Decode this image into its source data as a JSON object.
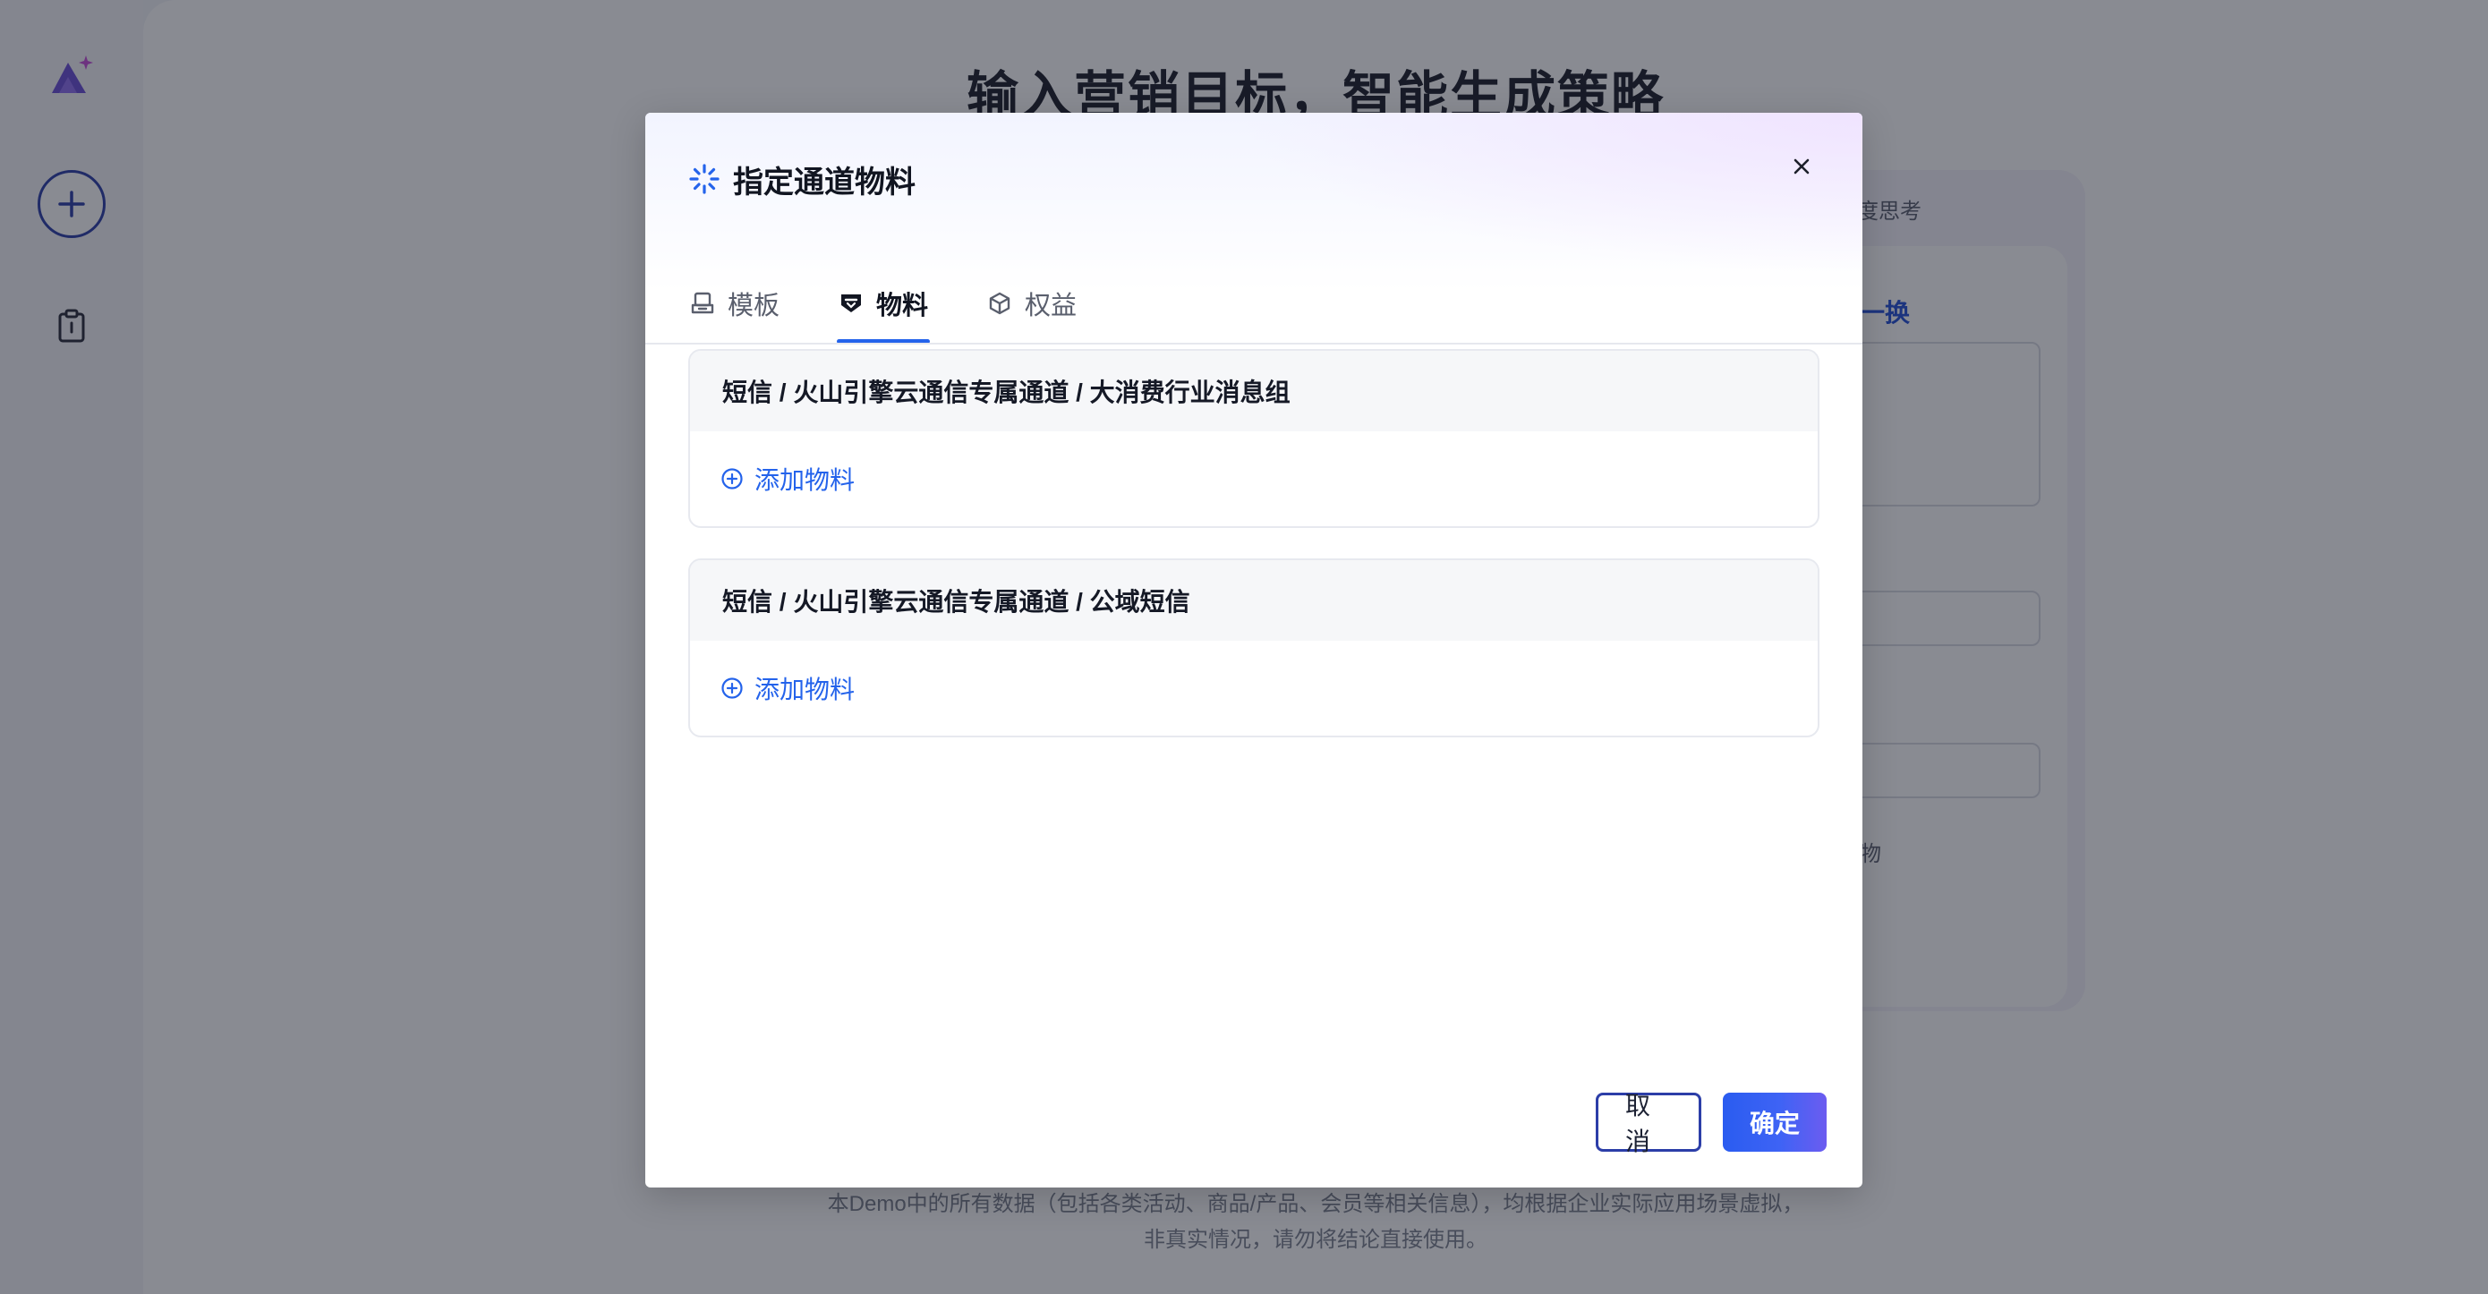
{
  "main": {
    "title": "输入营销目标，智能生成策略",
    "bg_fragments": [
      "度思考",
      "一换",
      "物"
    ],
    "disclaimer_line1": "本Demo中的所有数据（包括各类活动、商品/产品、会员等相关信息），均根据企业实际应用场景虚拟，",
    "disclaimer_line2": "非真实情况，请勿将结论直接使用。"
  },
  "modal": {
    "title": "指定通道物料",
    "tabs": [
      {
        "label": "模板",
        "icon": "template-icon",
        "active": false
      },
      {
        "label": "物料",
        "icon": "material-icon",
        "active": true
      },
      {
        "label": "权益",
        "icon": "cube-icon",
        "active": false
      }
    ],
    "groups": [
      {
        "title": "短信 / 火山引擎云通信专属通道 / 大消费行业消息组",
        "add_label": "添加物料"
      },
      {
        "title": "短信 / 火山引擎云通信专属通道 / 公域短信",
        "add_label": "添加物料"
      }
    ],
    "cancel_label": "取消",
    "confirm_label": "确定"
  },
  "colors": {
    "accent": "#2463eb",
    "brand_purple": "#6b4ed6",
    "overlay": "rgba(20,24,38,0.5)"
  }
}
